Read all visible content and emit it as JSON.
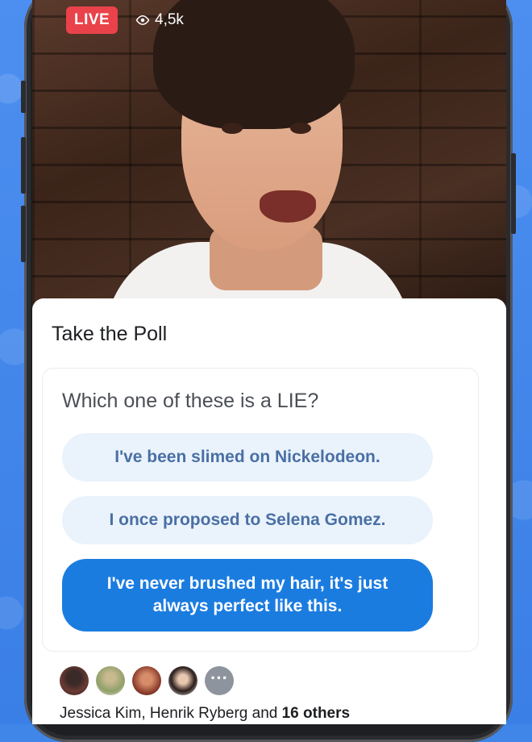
{
  "live_header": {
    "live_label": "LIVE",
    "viewer_count": "4,5k"
  },
  "poll": {
    "title": "Take the Poll",
    "question": "Which one of these is a LIE?",
    "options": [
      {
        "label": "I've been slimed on Nickelodeon.",
        "selected": false
      },
      {
        "label": "I once proposed to Selena Gomez.",
        "selected": false
      },
      {
        "label": "I've never brushed my hair, it's just always perfect like this.",
        "selected": true
      }
    ]
  },
  "participants": {
    "names": "Jessica Kim, Henrik Ryberg",
    "connector": " and ",
    "others": "16 others",
    "more_glyph": "···"
  },
  "colors": {
    "accent": "#1b7ce0",
    "live_red": "#e9424a",
    "option_bg": "#eaf3fc"
  }
}
